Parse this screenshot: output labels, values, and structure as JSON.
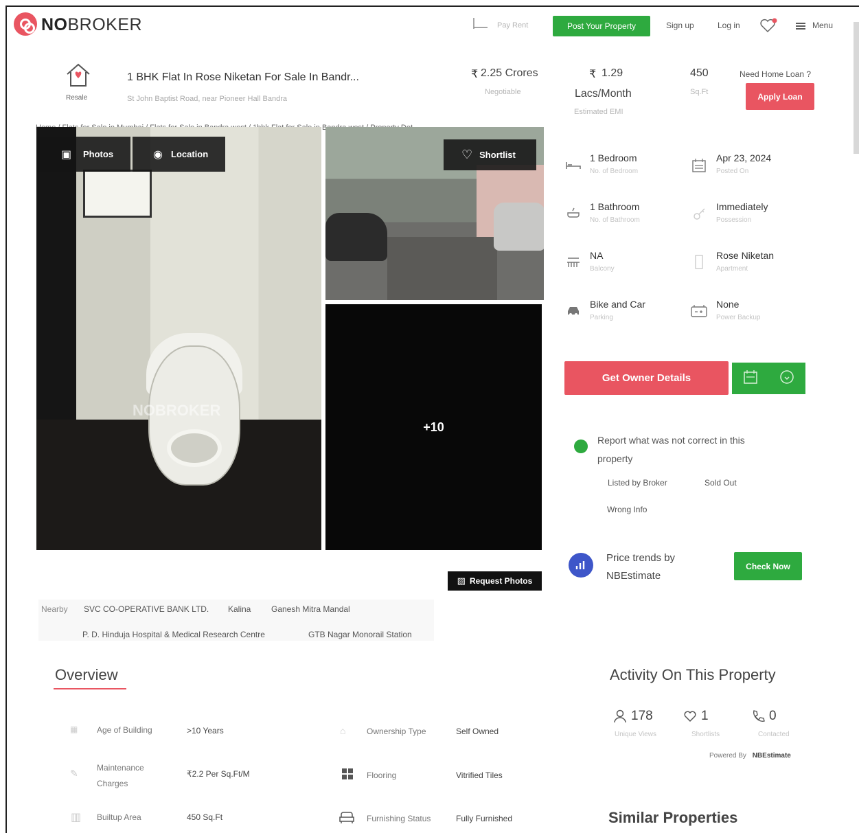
{
  "header": {
    "logo_no": "NO",
    "logo_broker": "BROKER",
    "pay_rent": "Pay Rent",
    "post_property": "Post Your Property",
    "sign_up": "Sign up",
    "log_in": "Log in",
    "menu": "Menu"
  },
  "listing": {
    "type_badge": "Resale",
    "title": "1 BHK Flat In Rose Niketan For Sale In Bandr...",
    "address": "St John Baptist Road, near Pioneer Hall Bandra",
    "breadcrumb": "Home / Flats for Sale in Mumbai / Flats for Sale in Bandra west / 1bhk Flat for Sale in Bandra west / Property Det",
    "price": "2.25 Crores",
    "price_note": "Negotiable",
    "emi": "1.29",
    "emi_unit": "Lacs/Month",
    "emi_note": "Estimated EMI",
    "area": "450",
    "area_unit": "Sq.Ft",
    "loan_question": "Need Home Loan ?",
    "apply_loan": "Apply Loan"
  },
  "photos": {
    "photos_btn": "Photos",
    "location_btn": "Location",
    "shortlist_btn": "Shortlist",
    "more_count": "+10",
    "watermark": "NOBROKER",
    "request_photos": "Request Photos"
  },
  "nearby": {
    "label": "Nearby",
    "places": [
      "SVC CO-OPERATIVE BANK LTD.",
      "Kalina",
      "Ganesh Mitra Mandal",
      "P. D. Hinduja Hospital & Medical Research Centre",
      "GTB Nagar Monorail Station"
    ]
  },
  "details": [
    {
      "value": "1 Bedroom",
      "label": "No. of Bedroom",
      "icon": "bed-icon"
    },
    {
      "value": "Apr 23, 2024",
      "label": "Posted On",
      "icon": "calendar-icon"
    },
    {
      "value": "1 Bathroom",
      "label": "No. of Bathroom",
      "icon": "bathtub-icon"
    },
    {
      "value": "Immediately",
      "label": "Possession",
      "icon": "key-icon"
    },
    {
      "value": "NA",
      "label": "Balcony",
      "icon": "balcony-icon"
    },
    {
      "value": "Rose Niketan",
      "label": "Apartment",
      "icon": "building-icon"
    },
    {
      "value": "Bike and Car",
      "label": "Parking",
      "icon": "car-icon"
    },
    {
      "value": "None",
      "label": "Power Backup",
      "icon": "battery-icon"
    }
  ],
  "cta": {
    "owner_details": "Get Owner Details"
  },
  "report": {
    "text": "Report what was not correct in this property",
    "options": [
      "Listed by Broker",
      "Sold Out",
      "Wrong Info"
    ]
  },
  "trends": {
    "text_line1": "Price trends by",
    "text_line2": "NBEstimate",
    "check_now": "Check Now"
  },
  "overview": {
    "title": "Overview",
    "rows": [
      {
        "label": "Age of Building",
        "value": ">10 Years",
        "icon": "building-age-icon"
      },
      {
        "label": "Ownership Type",
        "value": "Self Owned",
        "icon": "ownership-icon"
      },
      {
        "label": "Maintenance Charges",
        "value": "₹2.2 Per Sq.Ft/M",
        "icon": "maintenance-icon"
      },
      {
        "label": "Flooring",
        "value": "Vitrified Tiles",
        "icon": "flooring-icon"
      },
      {
        "label": "Builtup Area",
        "value": "450 Sq.Ft",
        "icon": "area-icon"
      },
      {
        "label": "Furnishing Status",
        "value": "Fully Furnished",
        "icon": "sofa-icon"
      }
    ]
  },
  "activity": {
    "title": "Activity On This Property",
    "views": "178",
    "views_label": "Unique Views",
    "shortlists": "1",
    "shortlists_label": "Shortlists",
    "contacted": "0",
    "contacted_label": "Contacted",
    "powered_by": "Powered By",
    "powered_brand": "NBEstimate"
  },
  "similar": {
    "title": "Similar Properties"
  },
  "colors": {
    "brand": "#e95561",
    "green": "#2eaa3f",
    "trend_blue": "#3e56c9"
  }
}
